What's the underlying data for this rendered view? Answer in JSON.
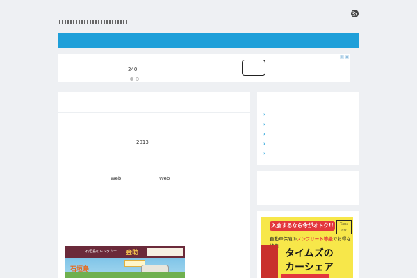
{
  "header": {
    "tagline": "□□□□□□□□□□□□□□□□□□□□□□□□□",
    "rss_label": "RSS"
  },
  "ad_carousel": {
    "count_text": "240",
    "slides": 2,
    "active_slide": 1,
    "close_marks": [
      "i",
      "x"
    ]
  },
  "main": {
    "year_text": "2013",
    "web_a": "Web",
    "web_b": "Web",
    "article_image": {
      "header_label": "石垣島のレンタカー",
      "brand": "金助",
      "island_text": "石垣島"
    }
  },
  "sidebar": {
    "links": [
      {
        "chevron": "›"
      },
      {
        "chevron": "›"
      },
      {
        "chevron": "›"
      },
      {
        "chevron": "›"
      },
      {
        "chevron": "›"
      }
    ],
    "ad": {
      "banner": "入会するなら今がオトク!!",
      "logo": "Times Car",
      "line_prefix": "自動車保険の",
      "line_highlight": "ノンフリート等級",
      "line_suffix": "でお得な特典",
      "big_line1": "タイムズの",
      "big_line2": "カーシェア"
    }
  },
  "colors": {
    "page_bg": "#eef0f3",
    "nav_blue": "#1e9fd9",
    "panel_bg": "#ffffff",
    "ad_yellow": "#f7e74a",
    "ad_red": "#e3373c"
  }
}
